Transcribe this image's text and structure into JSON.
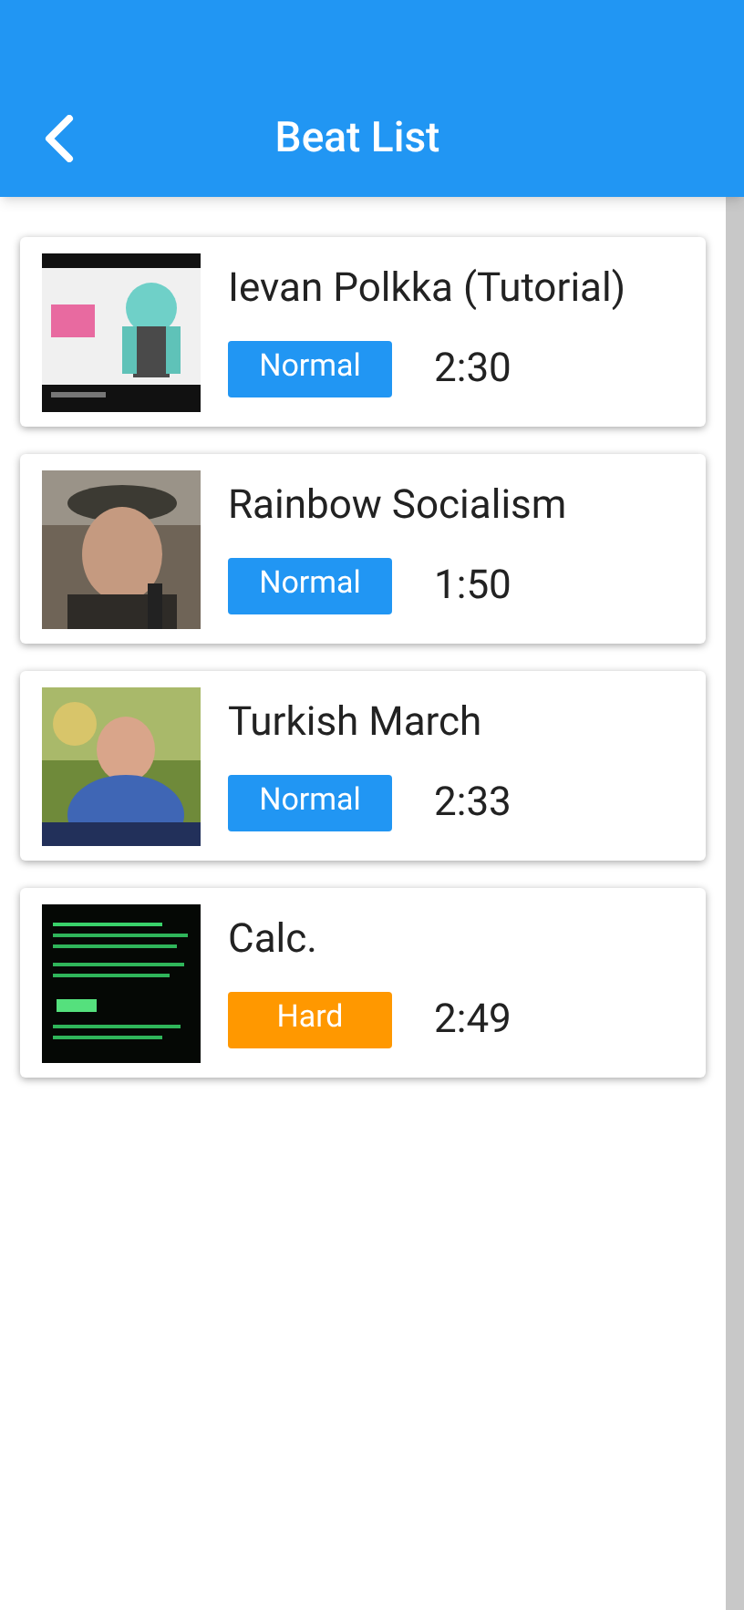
{
  "header": {
    "title": "Beat List"
  },
  "songs": [
    {
      "title": "Ievan Polkka (Tutorial)",
      "difficulty": "Normal",
      "color": "#2196f3",
      "duration": "2:30"
    },
    {
      "title": "Rainbow Socialism",
      "difficulty": "Normal",
      "color": "#2196f3",
      "duration": "1:50"
    },
    {
      "title": "Turkish March",
      "difficulty": "Normal",
      "color": "#2196f3",
      "duration": "2:33"
    },
    {
      "title": "Calc.",
      "difficulty": "Hard",
      "color": "#ff9800",
      "duration": "2:49"
    }
  ]
}
